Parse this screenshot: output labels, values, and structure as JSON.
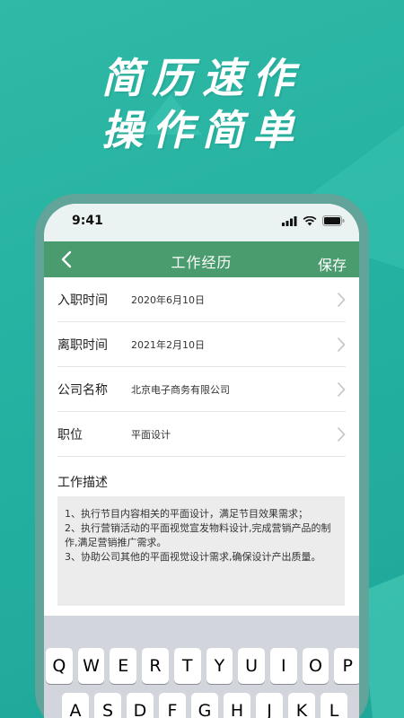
{
  "promo": {
    "line1": "简历速作",
    "line2": "操作简单"
  },
  "status_bar": {
    "time": "9:41",
    "icons": [
      "signal-icon",
      "wifi-icon",
      "battery-icon"
    ]
  },
  "nav": {
    "title": "工作经历",
    "save_label": "保存",
    "back_icon": "chevron-left-icon"
  },
  "form": {
    "rows": [
      {
        "label": "入职时间",
        "value": "2020年6月10日"
      },
      {
        "label": "离职时间",
        "value": "2021年2月10日"
      },
      {
        "label": "公司名称",
        "value": "北京电子商务有限公司"
      },
      {
        "label": "职位",
        "value": "平面设计"
      }
    ],
    "description_label": "工作描述",
    "description_lines": [
      "1、执行节目内容相关的平面设计，满足节目效果需求；",
      "2、执行营销活动的平面视觉宣发物料设计,完成营销产品的制作,满足营销推广需求。",
      "3、协助公司其他的平面视觉设计需求,确保设计产出质量。"
    ]
  },
  "keyboard": {
    "row1": [
      "Q",
      "W",
      "E",
      "R",
      "T",
      "Y",
      "U",
      "I",
      "O",
      "P"
    ],
    "row2": [
      "A",
      "S",
      "D",
      "F",
      "G",
      "H",
      "J",
      "K",
      "L"
    ]
  },
  "colors": {
    "background": "#23b0a0",
    "navbar": "#4a9b6e",
    "phone_frame": "#62a39a"
  }
}
